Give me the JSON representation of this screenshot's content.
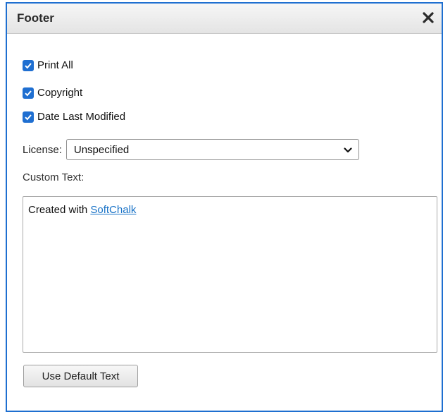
{
  "dialog": {
    "title": "Footer",
    "close_icon": "close-x-icon"
  },
  "options": [
    {
      "label": "Print All",
      "checked": true
    },
    {
      "label": "Copyright",
      "checked": true
    },
    {
      "label": "Date Last Modified",
      "checked": true
    }
  ],
  "license": {
    "label": "License:",
    "selected": "Unspecified",
    "icon": "chevron-down-icon"
  },
  "custom_text": {
    "label": "Custom Text:",
    "content_prefix": "Created with ",
    "link_text": "SoftChalk"
  },
  "buttons": {
    "use_default": "Use Default Text"
  },
  "colors": {
    "accent": "#1f6fd1",
    "link": "#1a73c7",
    "frame": "#1e6fd0"
  }
}
